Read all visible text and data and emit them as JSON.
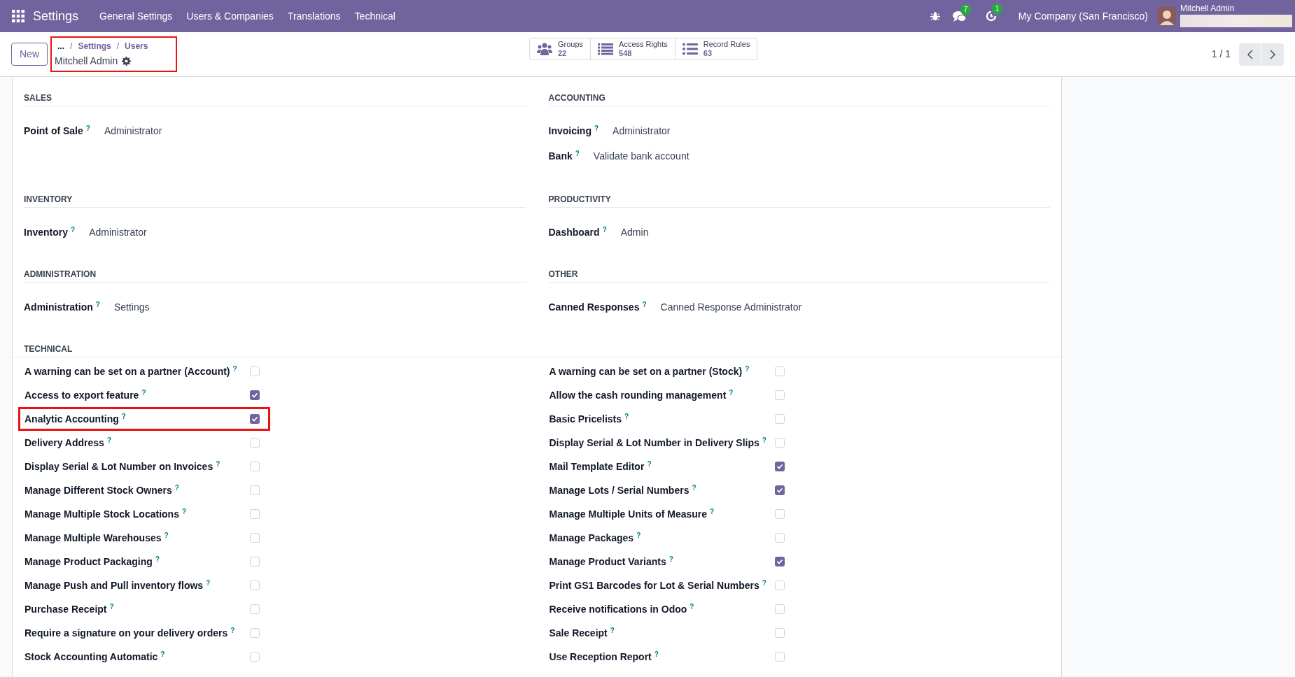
{
  "navbar": {
    "app_title": "Settings",
    "menu": [
      "General Settings",
      "Users & Companies",
      "Translations",
      "Technical"
    ],
    "messages_badge": "7",
    "activities_badge": "1",
    "company": "My Company (San Francisco)",
    "user": "Mitchell Admin"
  },
  "control_panel": {
    "new_button": "New",
    "breadcrumbs": [
      {
        "label": "..."
      },
      {
        "separator": "/",
        "label": "Settings"
      },
      {
        "separator": "/",
        "label": "Users"
      }
    ],
    "record_title": "Mitchell Admin",
    "breadcrumbs_highlighted": true,
    "smart_buttons": [
      {
        "kind": "groups",
        "label": "Groups",
        "count": "22"
      },
      {
        "kind": "list",
        "label": "Access Rights",
        "count": "548"
      },
      {
        "kind": "dotlist",
        "label": "Record Rules",
        "count": "63"
      }
    ],
    "pager": "1 / 1"
  },
  "sections": [
    {
      "title": "SALES",
      "fields": [
        {
          "label": "Point of Sale",
          "help": "?",
          "value": "Administrator"
        }
      ]
    },
    {
      "title": "ACCOUNTING",
      "fields": [
        {
          "label": "Invoicing",
          "help": "?",
          "value": "Administrator"
        },
        {
          "label": "Bank",
          "help": "?",
          "value": "Validate bank account"
        }
      ]
    },
    {
      "title": "INVENTORY",
      "fields": [
        {
          "label": "Inventory",
          "help": "?",
          "value": "Administrator"
        }
      ]
    },
    {
      "title": "PRODUCTIVITY",
      "fields": [
        {
          "label": "Dashboard",
          "help": "?",
          "value": "Admin"
        }
      ]
    },
    {
      "title": "ADMINISTRATION",
      "fields": [
        {
          "label": "Administration",
          "help": "?",
          "value": "Settings"
        }
      ]
    },
    {
      "title": "OTHER",
      "fields": [
        {
          "label": "Canned Responses",
          "help": "?",
          "value": "Canned Response Administrator"
        }
      ]
    }
  ],
  "technical": {
    "title": "TECHNICAL",
    "columns": [
      {
        "items": [
          {
            "label": "A warning can be set on a partner (Account)",
            "help": "?",
            "checked": false,
            "highlighted": false
          },
          {
            "label": "Access to export feature",
            "help": "?",
            "checked": true,
            "highlighted": false
          },
          {
            "label": "Analytic Accounting",
            "help": "?",
            "checked": true,
            "highlighted": true
          },
          {
            "label": "Delivery Address",
            "help": "?",
            "checked": false,
            "highlighted": false
          },
          {
            "label": "Display Serial & Lot Number on Invoices",
            "help": "?",
            "checked": false,
            "highlighted": false
          },
          {
            "label": "Manage Different Stock Owners",
            "help": "?",
            "checked": false,
            "highlighted": false
          },
          {
            "label": "Manage Multiple Stock Locations",
            "help": "?",
            "checked": false,
            "highlighted": false
          },
          {
            "label": "Manage Multiple Warehouses",
            "help": "?",
            "checked": false,
            "highlighted": false
          },
          {
            "label": "Manage Product Packaging",
            "help": "?",
            "checked": false,
            "highlighted": false
          },
          {
            "label": "Manage Push and Pull inventory flows",
            "help": "?",
            "checked": false,
            "highlighted": false
          },
          {
            "label": "Purchase Receipt",
            "help": "?",
            "checked": false,
            "highlighted": false
          },
          {
            "label": "Require a signature on your delivery orders",
            "help": "?",
            "checked": false,
            "highlighted": false
          },
          {
            "label": "Stock Accounting Automatic",
            "help": "?",
            "checked": false,
            "highlighted": false
          }
        ]
      },
      {
        "items": [
          {
            "label": "A warning can be set on a partner (Stock)",
            "help": "?",
            "checked": false,
            "highlighted": false
          },
          {
            "label": "Allow the cash rounding management",
            "help": "?",
            "checked": false,
            "highlighted": false
          },
          {
            "label": "Basic Pricelists",
            "help": "?",
            "checked": false,
            "highlighted": false
          },
          {
            "label": "Display Serial & Lot Number in Delivery Slips",
            "help": "?",
            "checked": false,
            "highlighted": false
          },
          {
            "label": "Mail Template Editor",
            "help": "?",
            "checked": true,
            "highlighted": false
          },
          {
            "label": "Manage Lots / Serial Numbers",
            "help": "?",
            "checked": true,
            "highlighted": false
          },
          {
            "label": "Manage Multiple Units of Measure",
            "help": "?",
            "checked": false,
            "highlighted": false
          },
          {
            "label": "Manage Packages",
            "help": "?",
            "checked": false,
            "highlighted": false
          },
          {
            "label": "Manage Product Variants",
            "help": "?",
            "checked": true,
            "highlighted": false
          },
          {
            "label": "Print GS1 Barcodes for Lot & Serial Numbers",
            "help": "?",
            "checked": false,
            "highlighted": false
          },
          {
            "label": "Receive notifications in Odoo",
            "help": "?",
            "checked": false,
            "highlighted": false
          },
          {
            "label": "Sale Receipt",
            "help": "?",
            "checked": false,
            "highlighted": false
          },
          {
            "label": "Use Reception Report",
            "help": "?",
            "checked": false,
            "highlighted": false
          }
        ]
      }
    ]
  }
}
